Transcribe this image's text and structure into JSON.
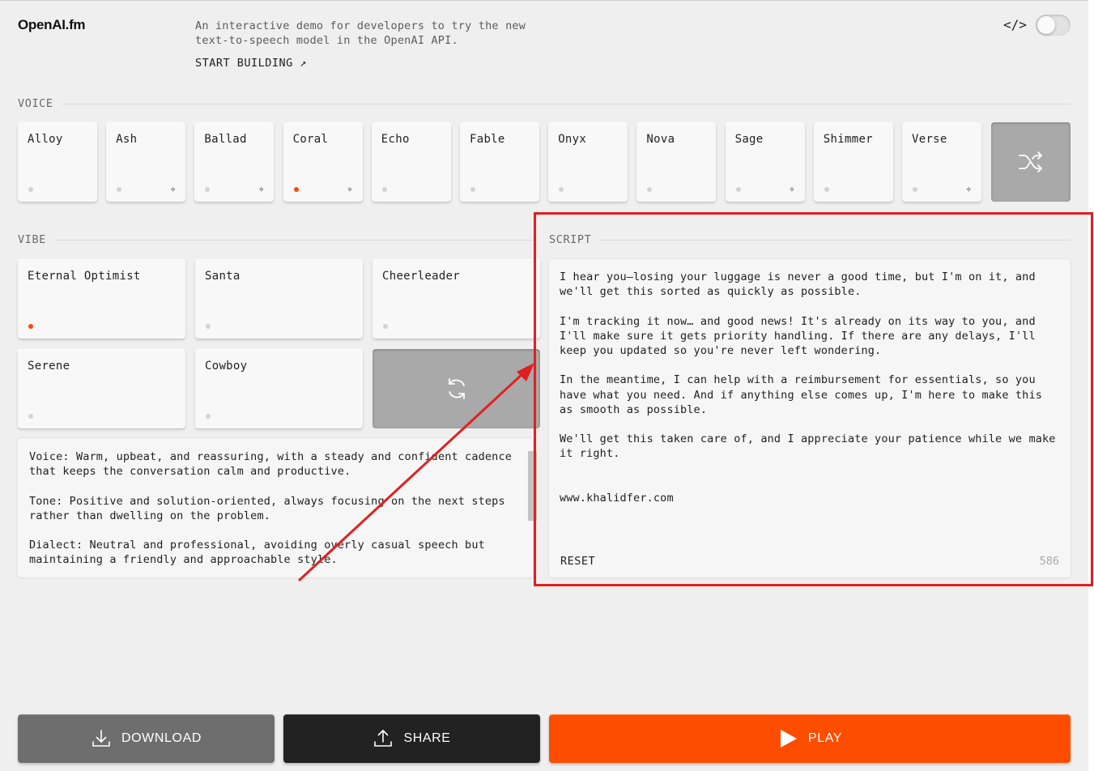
{
  "header": {
    "logo": "OpenAI.fm",
    "intro": "An interactive demo for developers to try the new text-to-speech model in the OpenAI API.",
    "start_link": "START BUILDING ↗",
    "code_icon": "</>"
  },
  "voice": {
    "label": "VOICE",
    "items": [
      {
        "name": "Alloy",
        "active": false,
        "starred": false
      },
      {
        "name": "Ash",
        "active": false,
        "starred": true
      },
      {
        "name": "Ballad",
        "active": false,
        "starred": true
      },
      {
        "name": "Coral",
        "active": true,
        "starred": true
      },
      {
        "name": "Echo",
        "active": false,
        "starred": false
      },
      {
        "name": "Fable",
        "active": false,
        "starred": false
      },
      {
        "name": "Onyx",
        "active": false,
        "starred": false
      },
      {
        "name": "Nova",
        "active": false,
        "starred": false
      },
      {
        "name": "Sage",
        "active": false,
        "starred": true
      },
      {
        "name": "Shimmer",
        "active": false,
        "starred": false
      },
      {
        "name": "Verse",
        "active": false,
        "starred": true
      }
    ],
    "shuffle_icon": "shuffle-icon"
  },
  "vibe": {
    "label": "VIBE",
    "items": [
      {
        "name": "Eternal Optimist",
        "active": true
      },
      {
        "name": "Santa",
        "active": false
      },
      {
        "name": "Cheerleader",
        "active": false
      },
      {
        "name": "Serene",
        "active": false
      },
      {
        "name": "Cowboy",
        "active": false
      }
    ],
    "refresh_icon": "refresh-icon",
    "description": "Voice: Warm, upbeat, and reassuring, with a steady and confident cadence that keeps the conversation calm and productive.\n\nTone: Positive and solution-oriented, always focusing on the next steps rather than dwelling on the problem.\n\nDialect: Neutral and professional, avoiding overly casual speech but maintaining a friendly and approachable style."
  },
  "script": {
    "label": "SCRIPT",
    "text": "I hear you—losing your luggage is never a good time, but I'm on it, and we'll get this sorted as quickly as possible.\n\nI'm tracking it now… and good news! It's already on its way to you, and I'll make sure it gets priority handling. If there are any delays, I'll keep you updated so you're never left wondering.\n\nIn the meantime, I can help with a reimbursement for essentials, so you have what you need. And if anything else comes up, I'm here to make this as smooth as possible.\n\nWe'll get this taken care of, and I appreciate your patience while we make it right.\n\n\nwww.khalidfer.com",
    "reset": "RESET",
    "count": "586"
  },
  "actions": {
    "download": "DOWNLOAD",
    "share": "SHARE",
    "play": "PLAY"
  },
  "colors": {
    "accent": "#ff4d00",
    "annotation": "#e02020",
    "background": "#efefef"
  }
}
